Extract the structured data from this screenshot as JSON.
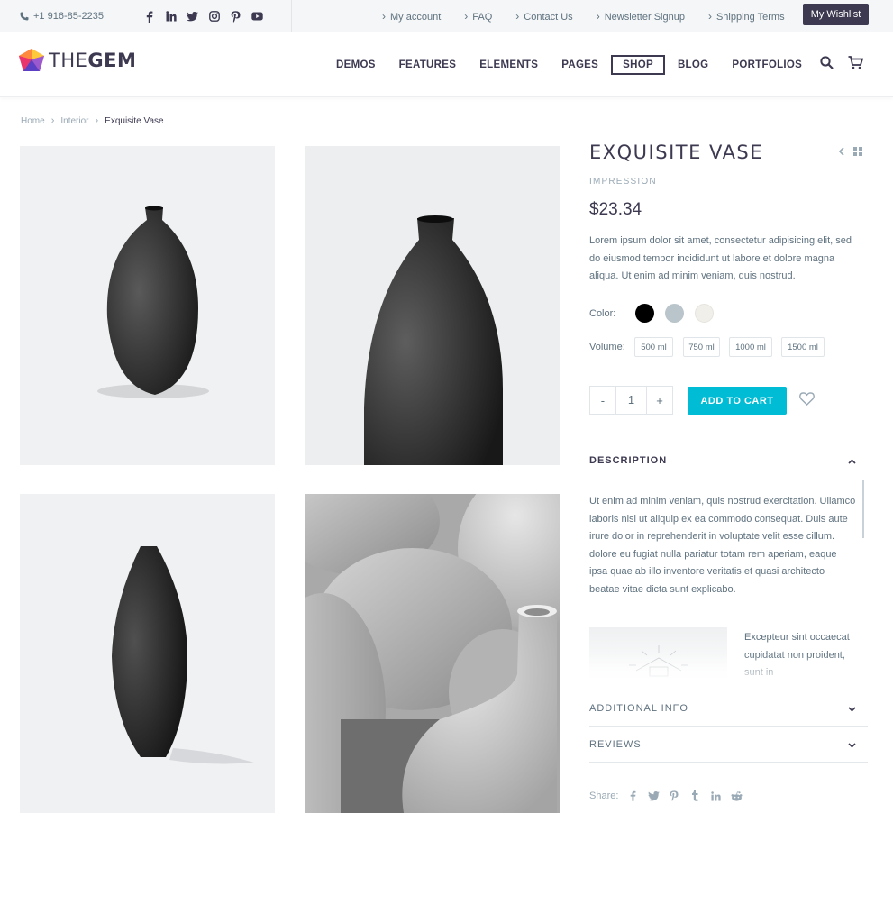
{
  "topbar": {
    "phone": "+1 916-85-2235",
    "social": [
      "facebook-icon",
      "linkedin-icon",
      "twitter-icon",
      "instagram-icon",
      "pinterest-icon",
      "youtube-icon"
    ],
    "links": [
      "My account",
      "FAQ",
      "Contact Us",
      "Newsletter Signup",
      "Shipping Terms"
    ],
    "wishlist": "My Wishlist"
  },
  "header": {
    "logo_light": "THE",
    "logo_bold": "GEM",
    "nav": [
      "DEMOS",
      "FEATURES",
      "ELEMENTS",
      "PAGES",
      "SHOP",
      "BLOG",
      "PORTFOLIOS"
    ],
    "active_nav": "SHOP"
  },
  "breadcrumb": [
    "Home",
    "Interior",
    "Exquisite Vase"
  ],
  "product": {
    "title": "EXQUISITE VASE",
    "category": "IMPRESSION",
    "price": "$23.34",
    "short_description": "Lorem ipsum dolor sit amet, consectetur adipisicing elit, sed do eiusmod tempor incididunt ut labore et dolore magna aliqua. Ut enim ad minim veniam, quis nostrud.",
    "color_label": "Color:",
    "colors": [
      "#000000",
      "#b9c5ca",
      "#f1efe9"
    ],
    "volume_label": "Volume:",
    "volumes": [
      "500 ml",
      "750 ml",
      "1000 ml",
      "1500 ml"
    ],
    "quantity": "1",
    "minus": "-",
    "plus": "+",
    "add_to_cart": "ADD TO CART"
  },
  "accordion": {
    "description_title": "DESCRIPTION",
    "description_text": "Ut enim ad minim veniam, quis nostrud exercitation. Ullamco laboris nisi ut aliquip ex ea commodo consequat. Duis aute irure dolor in reprehenderit in voluptate velit esse cillum. dolore eu fugiat nulla pariatur totam rem aperiam, eaque ipsa quae ab illo inventore veritatis et quasi architecto beatae vitae dicta sunt explicabo.",
    "side_text": "Excepteur sint occaecat cupidatat non proident, sunt in",
    "additional_title": "ADDITIONAL INFO",
    "reviews_title": "REVIEWS"
  },
  "share": {
    "label": "Share:",
    "icons": [
      "facebook-icon",
      "twitter-icon",
      "pinterest-icon",
      "tumblr-icon",
      "linkedin-icon",
      "reddit-icon"
    ]
  },
  "colors": {
    "accent": "#00bcd4",
    "dark": "#3c3950",
    "muted": "#99a9b5"
  }
}
